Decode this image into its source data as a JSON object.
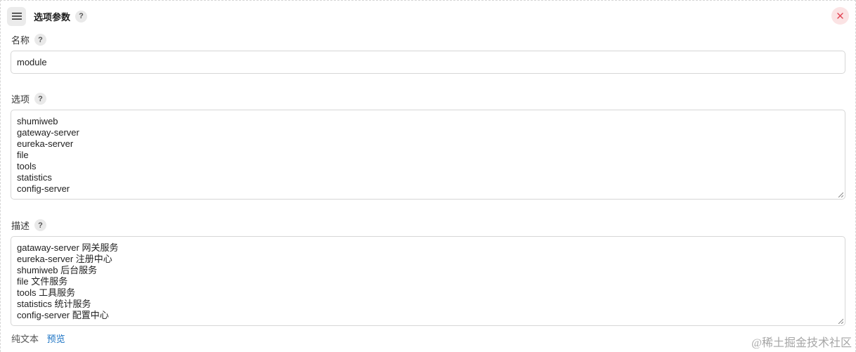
{
  "header": {
    "menu_icon": "hamburger-menu-icon",
    "title": "选项参数",
    "help": "?",
    "close_icon": "close-icon",
    "close_color": "#e04050"
  },
  "name_field": {
    "label": "名称",
    "help": "?",
    "value": "module"
  },
  "choices_field": {
    "label": "选项",
    "help": "?",
    "lines": [
      "shumiweb",
      "gateway-server",
      "eureka-server",
      "file",
      "tools",
      "statistics",
      "config-server"
    ]
  },
  "description_field": {
    "label": "描述",
    "help": "?",
    "lines": [
      "gataway-server 网关服务",
      "eureka-server 注册中心",
      "shumiweb 后台服务",
      "file 文件服务",
      "tools 工具服务",
      "statistics 统计服务",
      "config-server 配置中心"
    ]
  },
  "footer": {
    "plain_text": "纯文本",
    "preview": "预览",
    "link_color": "#1b73c4"
  },
  "watermark": "@稀土掘金技术社区"
}
